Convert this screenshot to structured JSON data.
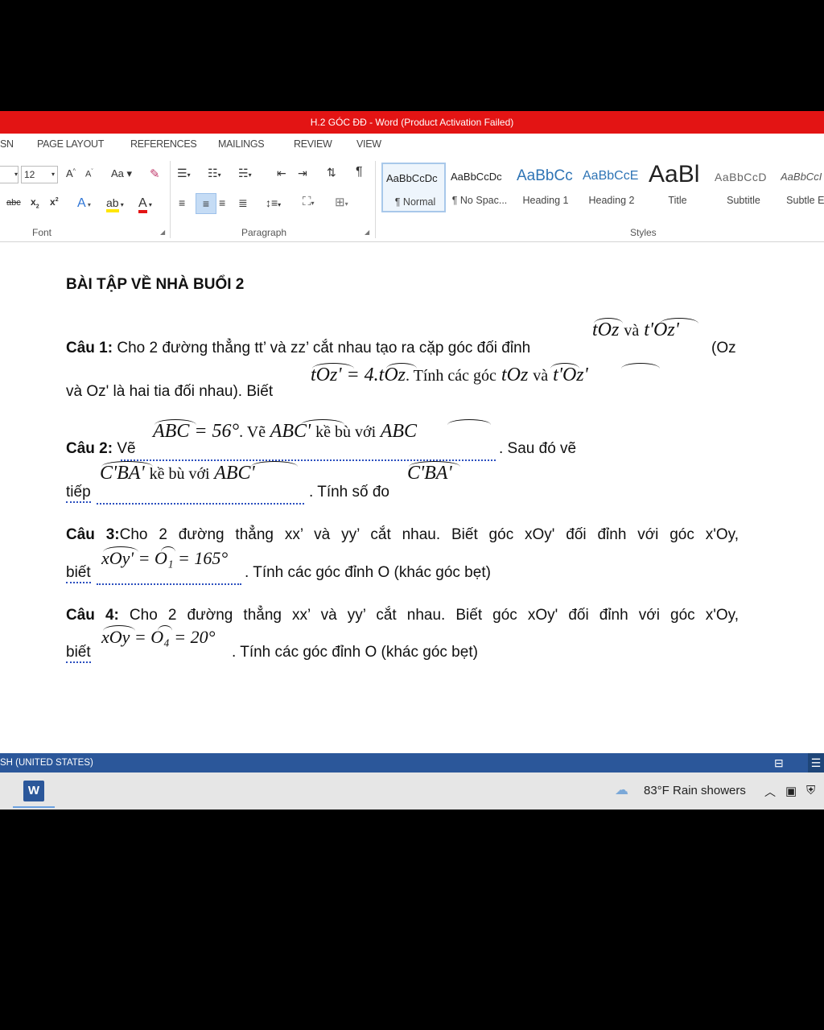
{
  "window": {
    "title": "H.2 GÓC ĐĐ -  Word (Product Activation Failed)"
  },
  "tabs": [
    "SN",
    "PAGE LAYOUT",
    "REFERENCES",
    "MAILINGS",
    "REVIEW",
    "VIEW"
  ],
  "ribbon": {
    "font_size": "12",
    "groups": {
      "font": "Font",
      "paragraph": "Paragraph",
      "styles": "Styles"
    },
    "styles": [
      {
        "sample": "AaBbCcDc",
        "name": "¶ Normal"
      },
      {
        "sample": "AaBbCcDc",
        "name": "¶ No Spac..."
      },
      {
        "sample": "AaBbCc",
        "name": "Heading 1"
      },
      {
        "sample": "AaBbCcE",
        "name": "Heading 2"
      },
      {
        "sample": "AaBl",
        "name": "Title"
      },
      {
        "sample": "AaBbCcD",
        "name": "Subtitle"
      },
      {
        "sample": "AaBbCcI",
        "name": "Subtle Em"
      }
    ]
  },
  "document": {
    "heading": "BÀI TẬP VỀ NHÀ BUỔI 2",
    "q1": {
      "label": "Câu 1:",
      "text1": " Cho 2 đường thẳng tt’ và zz’ cắt nhau tạo ra cặp góc đối đỉnh",
      "m_a": "tOz",
      "m_va": "và",
      "m_b": "t'Oz'",
      "tail": "(Oz",
      "text2": "và Oz' là hai tia đối nhau). Biết",
      "m_c": "tOz' = 4.tOz",
      "m_tinh": ". Tính các góc",
      "m_d": "tOz",
      "m_va2": "và",
      "m_e": "t'Oz'"
    },
    "q2": {
      "label": "Câu 2:",
      "ve": " Vẽ",
      "m_a": "ABC = 56°",
      "m_mid": ". Vẽ",
      "m_b": "ABC'",
      "m_kb": "kề bù với",
      "m_c": "ABC",
      "tail": ". Sau đó vẽ",
      "tiep": "tiếp",
      "m_d": "C'BA'",
      "m_kb2": "kề bù với",
      "m_e": "ABC'",
      "tail2": ". Tính số đo",
      "m_f": "C'BA'"
    },
    "q3": {
      "label": "Câu 3:",
      "text1": "Cho 2 đường thẳng xx’ và yy’ cắt nhau. Biết góc xOy' đối đỉnh với góc x'Oy,",
      "biet": "biết",
      "m_a": "xOy' = O₁ = 165°",
      "tail": ". Tính các góc đỉnh O (khác góc bẹt)"
    },
    "q4": {
      "label": "Câu 4:",
      "text1": " Cho 2 đường thẳng xx’ và yy’ cắt nhau. Biết góc xOy' đối đỉnh với góc x'Oy,",
      "biet": "biết",
      "m_a": "xOy = O₄ = 20°",
      "tail": ". Tính các góc đỉnh O (khác góc bẹt)"
    }
  },
  "statusbar": {
    "language": "SH (UNITED STATES)"
  },
  "taskbar": {
    "app_letter": "W",
    "weather": "83°F  Rain showers"
  }
}
